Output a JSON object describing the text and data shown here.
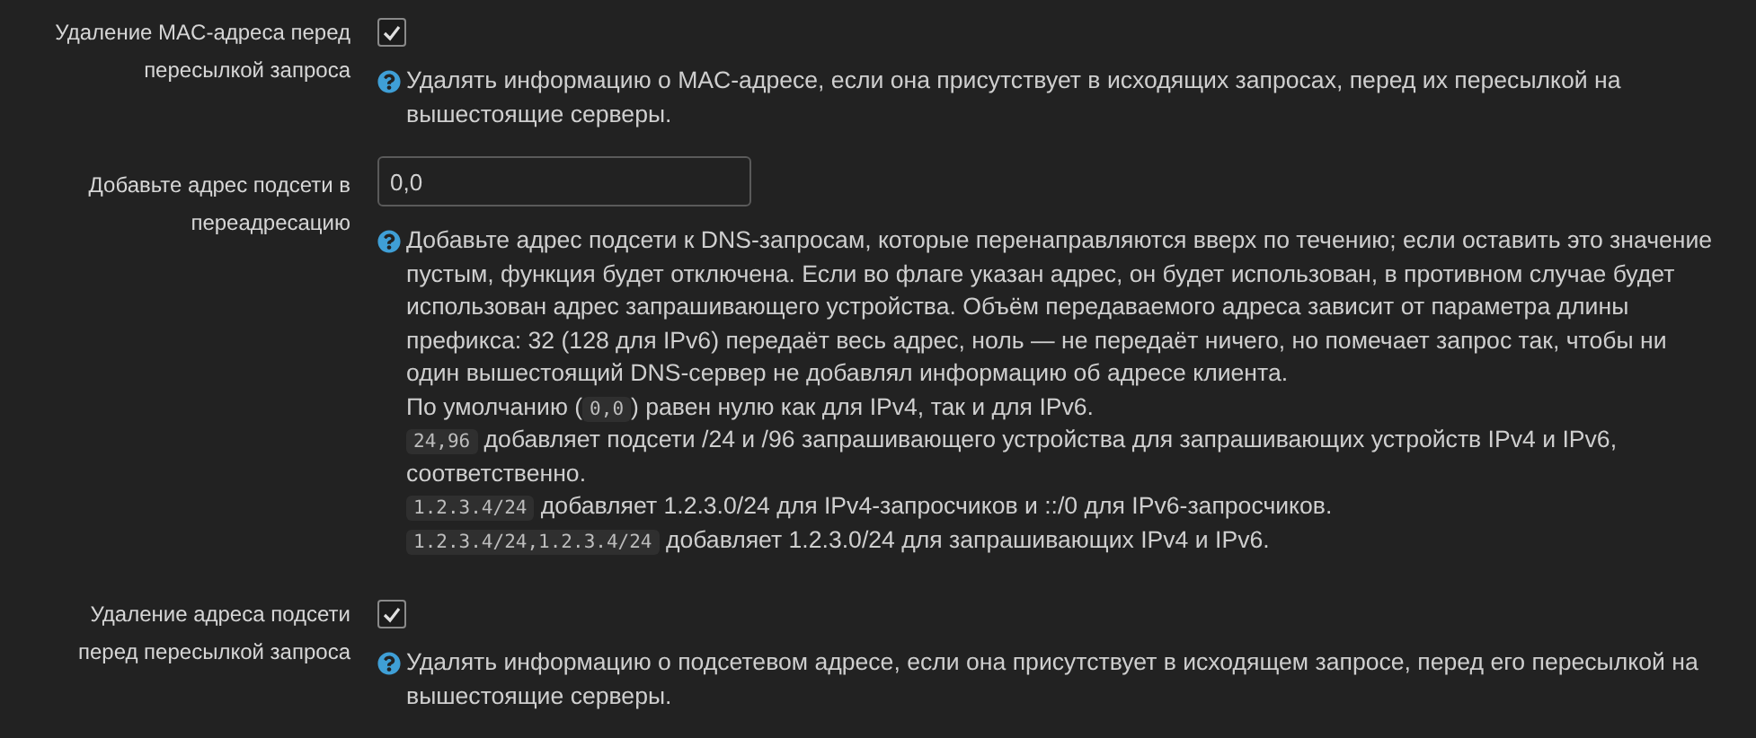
{
  "rows": [
    {
      "label": "Удаление MAC-адреса перед пересылкой запроса",
      "kind": "checkbox",
      "checked": true,
      "help": [
        [
          {
            "kind": "text",
            "text": "Удалять информацию о MAC-адресе, если она присутствует в исходящих запросах, перед их пересылкой на вышестоящие серверы."
          }
        ]
      ]
    },
    {
      "label": "Добавьте адрес подсети в переадресацию",
      "kind": "text",
      "value": "0,0",
      "help": [
        [
          {
            "kind": "text",
            "text": "Добавьте адрес подсети к DNS-запросам, которые перенаправляются вверх по течению; если оставить это значение пустым, функция будет отключена. Если во флаге указан адрес, он будет использован, в противном случае будет использован адрес запрашивающего устройства. Объём передаваемого адреса зависит от параметра длины префикса: 32 (128 для IPv6) передаёт весь адрес, ноль — не передаёт ничего, но помечает запрос так, чтобы ни один вышестоящий DNS-сервер не добавлял информацию об адресе клиента."
          }
        ],
        [
          {
            "kind": "text",
            "text": "По умолчанию ("
          },
          {
            "kind": "code",
            "text": "0,0"
          },
          {
            "kind": "text",
            "text": ") равен нулю как для IPv4, так и для IPv6."
          }
        ],
        [
          {
            "kind": "code",
            "text": "24,96"
          },
          {
            "kind": "text",
            "text": " добавляет подсети /24 и /96 запрашивающего устройства для запрашивающих устройств IPv4 и IPv6, соответственно."
          }
        ],
        [
          {
            "kind": "code",
            "text": "1.2.3.4/24"
          },
          {
            "kind": "text",
            "text": " добавляет 1.2.3.0/24 для IPv4-запросчиков и ::/0 для IPv6-запросчиков."
          }
        ],
        [
          {
            "kind": "code",
            "text": "1.2.3.4/24,1.2.3.4/24"
          },
          {
            "kind": "text",
            "text": " добавляет 1.2.3.0/24 для запрашивающих IPv4 и IPv6."
          }
        ]
      ]
    },
    {
      "label": "Удаление адреса подсети перед пересылкой запроса",
      "kind": "checkbox",
      "checked": true,
      "help": [
        [
          {
            "kind": "text",
            "text": "Удалять информацию о подсетевом адресе, если она присутствует в исходящем запросе, перед его пересылкой на вышестоящие серверы."
          }
        ]
      ]
    }
  ]
}
